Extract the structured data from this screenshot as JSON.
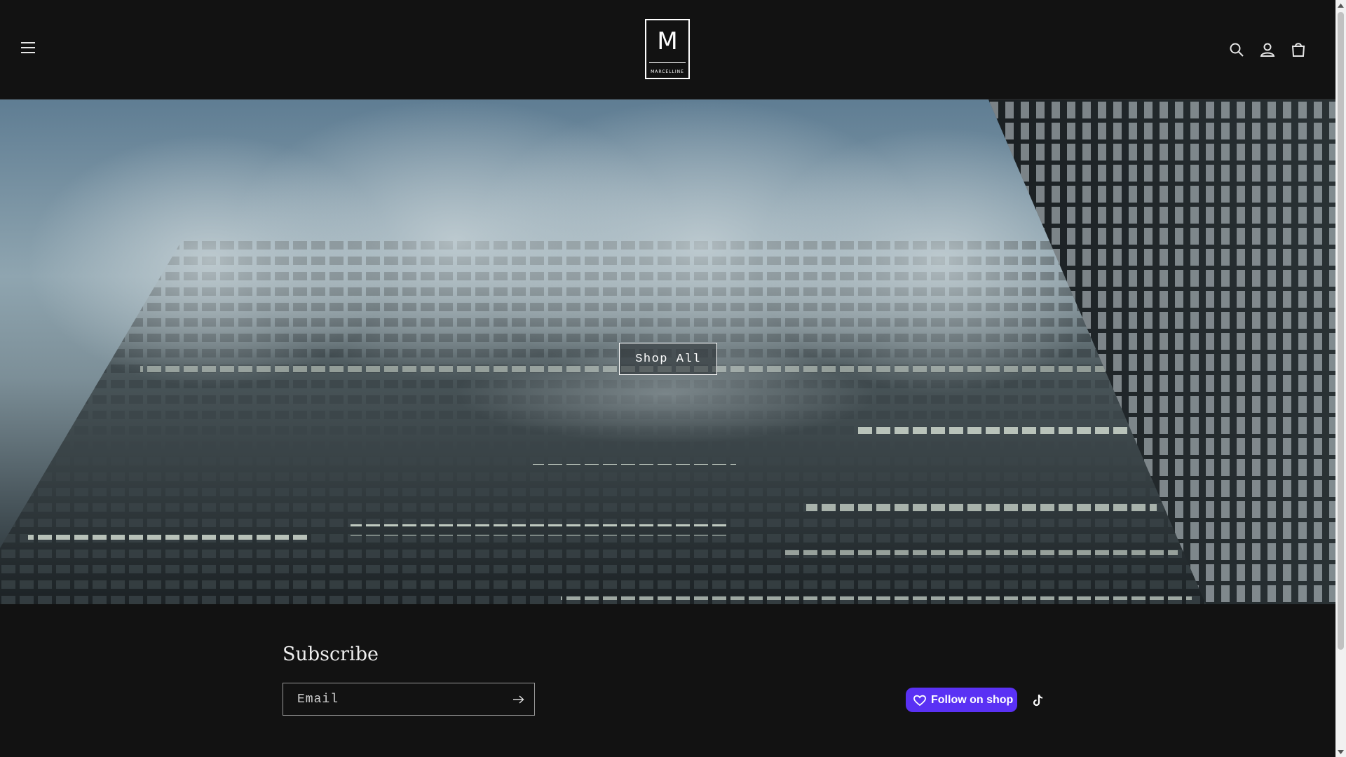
{
  "header": {
    "menu_icon": "hamburger-menu-icon",
    "logo": {
      "letter": "M",
      "subtitle": "MARCELLINE"
    },
    "icons": [
      "search-icon",
      "account-icon",
      "cart-icon"
    ]
  },
  "hero": {
    "image_description": "foggy high-rise office tower at night",
    "cta_label": "Shop All"
  },
  "footer": {
    "subscribe_title": "Subscribe",
    "email_placeholder": "Email",
    "submit_icon": "arrow-right-icon",
    "follow_label": "Follow on shop",
    "social_icon": "tiktok-icon"
  },
  "colors": {
    "background": "#121212",
    "shop_purple": "#5a31f4",
    "text": "#ffffff"
  }
}
